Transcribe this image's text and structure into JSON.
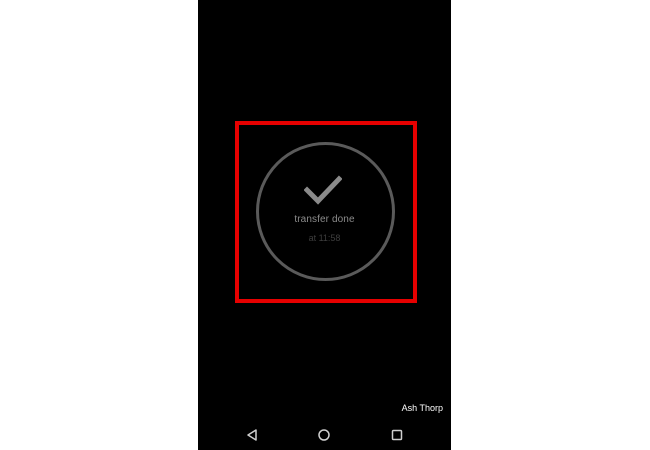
{
  "notification": {
    "title": "transfer done",
    "time": "at 11:58",
    "icon": "checkmark-icon"
  },
  "overlay": {
    "credit": "Ash Thorp"
  },
  "navigation": {
    "buttons": [
      {
        "icon": "back-triangle-icon"
      },
      {
        "icon": "home-circle-icon"
      },
      {
        "icon": "recents-square-icon"
      }
    ]
  },
  "colors": {
    "background": "#000000",
    "highlight": "#e60000",
    "ring": "#5a5a5a",
    "text_primary": "#8c8c8c",
    "text_secondary": "#3e3e3e"
  }
}
